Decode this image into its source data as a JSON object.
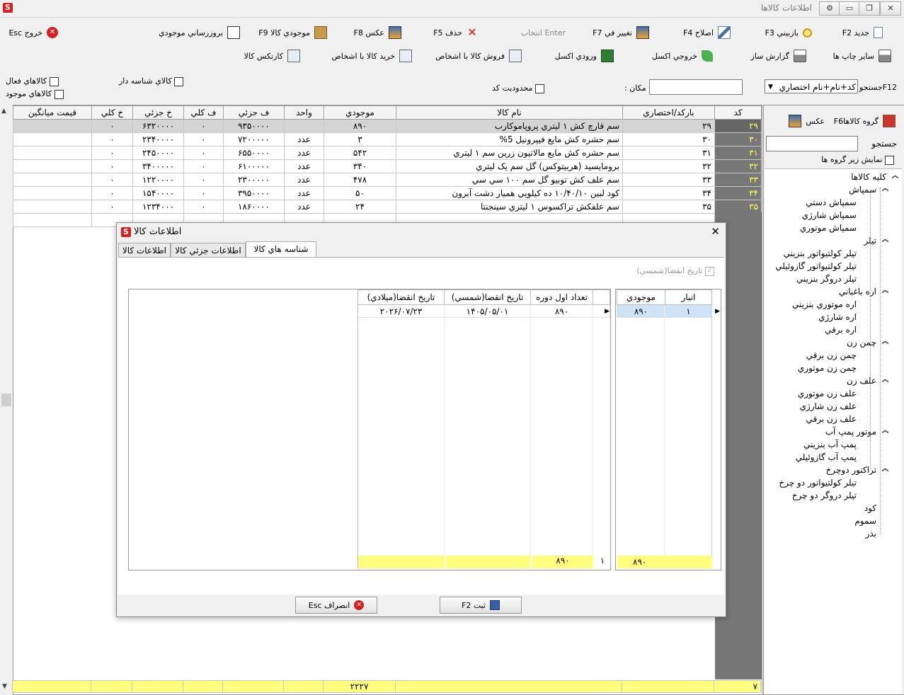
{
  "window": {
    "title": "اطلاعات کالاها",
    "buttons": [
      "▭",
      "❐",
      "✕"
    ]
  },
  "toolbar": {
    "row1": [
      {
        "label": "جديد F2",
        "icon": "new-doc-icon"
      },
      {
        "label": "بازبيني F3",
        "icon": "glasses-icon"
      },
      {
        "label": "اصلاح F4",
        "icon": "edit-icon"
      },
      {
        "label": "تغيير في F7",
        "icon": "change-icon"
      },
      {
        "label": "Enter انتخاب",
        "icon": ""
      },
      {
        "label": "حذف F5",
        "icon": "delete-icon"
      },
      {
        "label": "عکس F8",
        "icon": "photo-icon"
      },
      {
        "label": "موجودي کالا F9",
        "icon": "stock-icon"
      },
      {
        "label": "بروزرساني موجودي",
        "icon": "update-stock-icon"
      },
      {
        "label": "خروج Esc",
        "icon": "exit-icon"
      }
    ],
    "row2": [
      {
        "label": "ساير چاپ ها",
        "icon": "printer-icon"
      },
      {
        "label": "گزارش ساز",
        "icon": "report-builder-icon"
      },
      {
        "label": "خروجي اکسل",
        "icon": "excel-export-icon"
      },
      {
        "label": "ورودي اکسل",
        "icon": "excel-import-icon"
      },
      {
        "label": "فروش کالا با اشخاص",
        "icon": "sales-icon"
      },
      {
        "label": "خريد کالا با اشخاص",
        "icon": "purchase-icon"
      },
      {
        "label": "کارتکس کالا",
        "icon": "kardex-icon"
      }
    ]
  },
  "filters": {
    "search_label": "F12جستجو",
    "search_mode": "کد+نام+نام اختصاري",
    "place_label": "مکان :",
    "code_limit_label": "محدوديت کد",
    "serial_goods_label": "کالاي شناسه دار",
    "active_goods_label": "کالاهاي فعال",
    "available_goods_label": "کالاهاي موجود"
  },
  "grid": {
    "columns": [
      "کد",
      "بارکد/اختصاري",
      "نام کالا",
      "موجودي",
      "واحد",
      "ف جزئي",
      "ف کلي",
      "خ جزئي",
      "خ کلي",
      "قيمت ميانگين"
    ],
    "rows": [
      [
        "۲۹",
        "۲۹",
        "سم قارچ کش ۱ ليتري پروپاموکارب",
        "۸۹۰",
        "",
        "۹۳۵۰۰۰۰",
        "۰",
        "۶۳۲۰۰۰۰",
        "۰",
        ""
      ],
      [
        "۳۰",
        "۳۰",
        "سم حشره کش مايع فيپرونيل 5%",
        "۳",
        "عدد",
        "۷۲۰۰۰۰۰",
        "۰",
        "۲۳۴۰۰۰۰",
        "۰",
        ""
      ],
      [
        "۳۱",
        "۳۱",
        "سم حشره کش مايع مالاتيون زرين سم ۱ ليتري",
        "۵۴۲",
        "عدد",
        "۶۵۵۰۰۰۰",
        "۰",
        "۲۴۵۰۰۰۰",
        "۰",
        ""
      ],
      [
        "۳۲",
        "۳۲",
        "برومايسيد (هربيتوکس) گل سم يک ليتري",
        "۳۴۰",
        "عدد",
        "۶۱۰۰۰۰۰",
        "۰",
        "۳۴۰۰۰۰۰",
        "۰",
        ""
      ],
      [
        "۳۳",
        "۳۳",
        "سم علف کش توبيو گل سم ۱۰۰ سي سي",
        "۴۷۸",
        "عدد",
        "۲۳۰۰۰۰۰",
        "۰",
        "۱۲۲۰۰۰۰",
        "۰",
        ""
      ],
      [
        "۳۴",
        "۳۴",
        "کود لبين ۱۰/۴۰/۱۰ ده کيلويي هميار دشت آبرون",
        "۵۰",
        "عدد",
        "۳۹۵۰۰۰۰",
        "۰",
        "۱۵۴۰۰۰۰",
        "۰",
        ""
      ],
      [
        "۳۵",
        "۳۵",
        "سم علفکش تراکسوس ۱ ليتري سينجنتا",
        "۲۴",
        "عدد",
        "۱۸۶۰۰۰۰",
        "۰",
        "۱۲۳۴۰۰۰",
        "۰",
        ""
      ]
    ],
    "row_units": [
      "عدد"
    ],
    "footer": {
      "count": "۷",
      "total_stock": "۲۲۲۷"
    }
  },
  "sidebar": {
    "group_button": "گروه کالاهاF6",
    "photo_button": "عکس",
    "search_label": "جستجو",
    "show_subgroups_label": "نمايش زير گروه ها",
    "tree": [
      {
        "label": "کليه کالاها",
        "level": 0,
        "exp": true
      },
      {
        "label": "سمپاش",
        "level": 1,
        "exp": true
      },
      {
        "label": "سمپاش دستي",
        "level": 2
      },
      {
        "label": "سمپاش شارژي",
        "level": 2
      },
      {
        "label": "سمپاش موتوري",
        "level": 2
      },
      {
        "label": "تيلر",
        "level": 1,
        "exp": true
      },
      {
        "label": "تيلر کولتيواتور بنزيني",
        "level": 2
      },
      {
        "label": "تيلر کولتيواتور گازوئيلي",
        "level": 2
      },
      {
        "label": "تيلر دروگر بنزيني",
        "level": 2
      },
      {
        "label": "اره باغباني",
        "level": 1,
        "exp": true
      },
      {
        "label": "اره موتوري بنزيني",
        "level": 2
      },
      {
        "label": "اره شارژي",
        "level": 2
      },
      {
        "label": "اره برقي",
        "level": 2
      },
      {
        "label": "چمن زن",
        "level": 1,
        "exp": true
      },
      {
        "label": "چمن زن برقي",
        "level": 2
      },
      {
        "label": "چمن زن موتوري",
        "level": 2
      },
      {
        "label": "علف زن",
        "level": 1,
        "exp": true
      },
      {
        "label": "علف زن موتوري",
        "level": 2
      },
      {
        "label": "علف زن شارژي",
        "level": 2
      },
      {
        "label": "علف زن برقي",
        "level": 2
      },
      {
        "label": "موتور پمپ آب",
        "level": 1,
        "exp": true
      },
      {
        "label": "پمپ آب بنزيني",
        "level": 2
      },
      {
        "label": "پمپ آب گازوئيلي",
        "level": 2
      },
      {
        "label": "تراکتور دوچرخ",
        "level": 1,
        "exp": true
      },
      {
        "label": "تيلر کولتيواتور دو چرخ",
        "level": 2
      },
      {
        "label": "تيلر دروگر دو چرخ",
        "level": 2
      },
      {
        "label": "کود",
        "level": 1
      },
      {
        "label": "سموم",
        "level": 1
      },
      {
        "label": "بذر",
        "level": 1
      }
    ]
  },
  "dialog": {
    "title": "اطلاعات کالا",
    "close": "✕",
    "tabs": [
      "شناسه هاي کالا",
      "اطلاعات جزئي کالا",
      "اطلاعات کالا"
    ],
    "expiry_checkbox_label": "تاريخ انقضا(شمسي)",
    "warehouse_table": {
      "columns": [
        "انبار",
        "موجودي"
      ],
      "rows": [
        [
          "۱",
          "۸۹۰"
        ]
      ],
      "footer": [
        "",
        "۸۹۰"
      ]
    },
    "serial_table": {
      "columns": [
        "",
        "تعداد اول دوره",
        "تاريخ انقضا(شمسي)",
        "تاريخ انقضا(ميلادي)"
      ],
      "rows": [
        [
          "",
          "۸۹۰",
          "۱۴۰۵/۰۵/۰۱",
          "۲۰۲۶/۰۷/۲۳"
        ]
      ],
      "footer": [
        "۱",
        "۸۹۰",
        "",
        ""
      ]
    },
    "save_button": "ثبت  F2",
    "cancel_button": "انصراف  Esc"
  },
  "colors": {
    "code_bg": "#777777",
    "code_fg": "#ffff66",
    "footer_bg": "#ffff80",
    "selected_row": "#d5d5d5",
    "warehouse_sel": "#cfe3f7"
  }
}
